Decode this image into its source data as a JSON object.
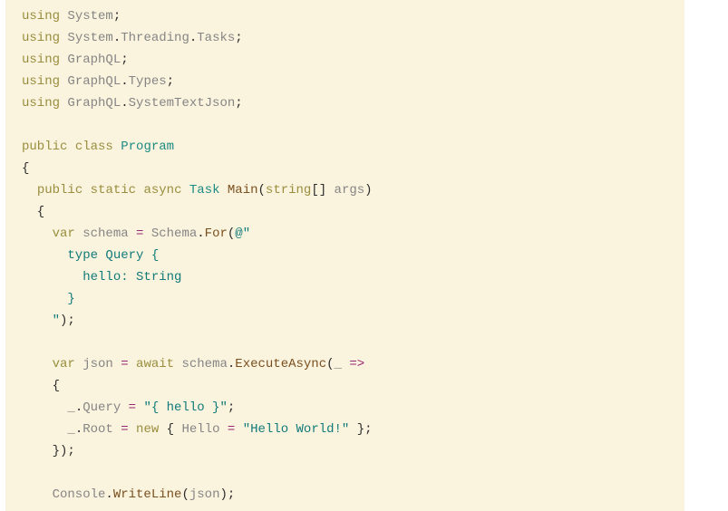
{
  "code": {
    "l1": {
      "using": "using",
      "ns": "System",
      "semi": ";"
    },
    "l2": {
      "using": "using",
      "ns1": "System",
      "dot1": ".",
      "ns2": "Threading",
      "dot2": ".",
      "ns3": "Tasks",
      "semi": ";"
    },
    "l3": {
      "using": "using",
      "ns": "GraphQL",
      "semi": ";"
    },
    "l4": {
      "using": "using",
      "ns1": "GraphQL",
      "dot": ".",
      "ns2": "Types",
      "semi": ";"
    },
    "l5": {
      "using": "using",
      "ns1": "GraphQL",
      "dot": ".",
      "ns2": "SystemTextJson",
      "semi": ";"
    },
    "l7": {
      "pub": "public",
      "cls": "class",
      "name": "Program"
    },
    "l8": {
      "brace": "{"
    },
    "l9": {
      "pub": "public",
      "stat": "static",
      "async": "async",
      "task": "Task",
      "main": "Main",
      "lp": "(",
      "str": "string",
      "br": "[]",
      "args": " args",
      "rp": ")"
    },
    "l10": {
      "brace": "  {"
    },
    "l11": {
      "var": "var",
      "schema": " schema ",
      "eq": "=",
      "sch": " Schema",
      "dot": ".",
      "for": "For",
      "lp": "(",
      "at": "@\""
    },
    "l12": {
      "txt": "      type Query {"
    },
    "l13": {
      "txt": "        hello: String"
    },
    "l14": {
      "txt": "      }"
    },
    "l15": {
      "txt": "    \"",
      "rp": ");"
    },
    "l17": {
      "var": "var",
      "json": " json ",
      "eq": "=",
      "await": " await",
      "schema": " schema",
      "dot": ".",
      "exec": "ExecuteAsync",
      "lp": "(",
      "lam": "_ ",
      "arrow": "=>"
    },
    "l18": {
      "brace": "    {"
    },
    "l19": {
      "pfx": "      _",
      "dot": ".",
      "query": "Query ",
      "eq": "=",
      "str": " \"{ hello }\"",
      "semi": ";"
    },
    "l20": {
      "pfx": "      _",
      "dot": ".",
      "root": "Root ",
      "eq": "=",
      "sp": " ",
      "new": "new",
      "sp2": " { ",
      "hello": "Hello ",
      "eq2": "=",
      "str": " \"Hello World!\"",
      "sp3": " };"
    },
    "l21": {
      "brace": "    });"
    },
    "l23": {
      "cons": "    Console",
      "dot": ".",
      "wl": "WriteLine",
      "lp": "(",
      "json": "json",
      "rp": ");"
    }
  }
}
